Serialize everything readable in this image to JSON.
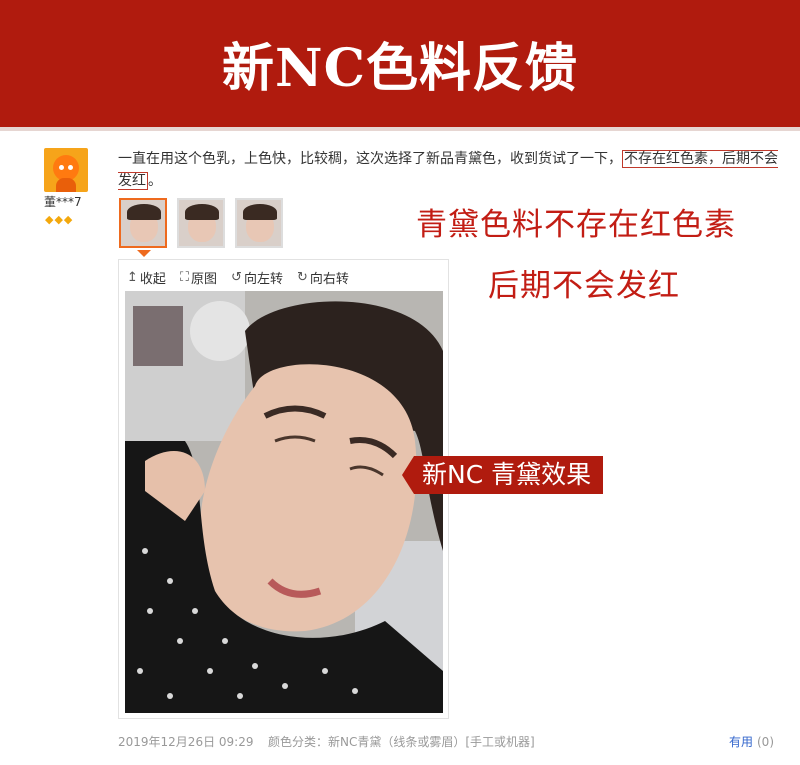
{
  "banner": {
    "title": "新NC色料反馈"
  },
  "reviewer": {
    "name": "董***7",
    "level_icons": "◆◆◆"
  },
  "review": {
    "text_before": "一直在用这个色乳，上色快，比较稠，这次选择了新品青黛色，收到货试了一下，",
    "highlight": "不存在红色素，后期不会发红",
    "text_after": "。"
  },
  "promo": {
    "line1": "青黛色料不存在红色素",
    "line2": "后期不会发红"
  },
  "viewer_toolbar": {
    "collapse": "收起",
    "original": "原图",
    "rotate_left": "向左转",
    "rotate_right": "向右转"
  },
  "callout": {
    "label": "新NC 青黛效果"
  },
  "footer": {
    "date": "2019年12月26日 09:29",
    "spec": "颜色分类：新NC青黛（线条或雾眉）[手工或机器]",
    "useful_label": "有用",
    "useful_count": "(0)"
  },
  "colors": {
    "brand_red": "#b01b0e",
    "highlight_red": "#c21d14",
    "active_thumb": "#ee6a1e"
  }
}
